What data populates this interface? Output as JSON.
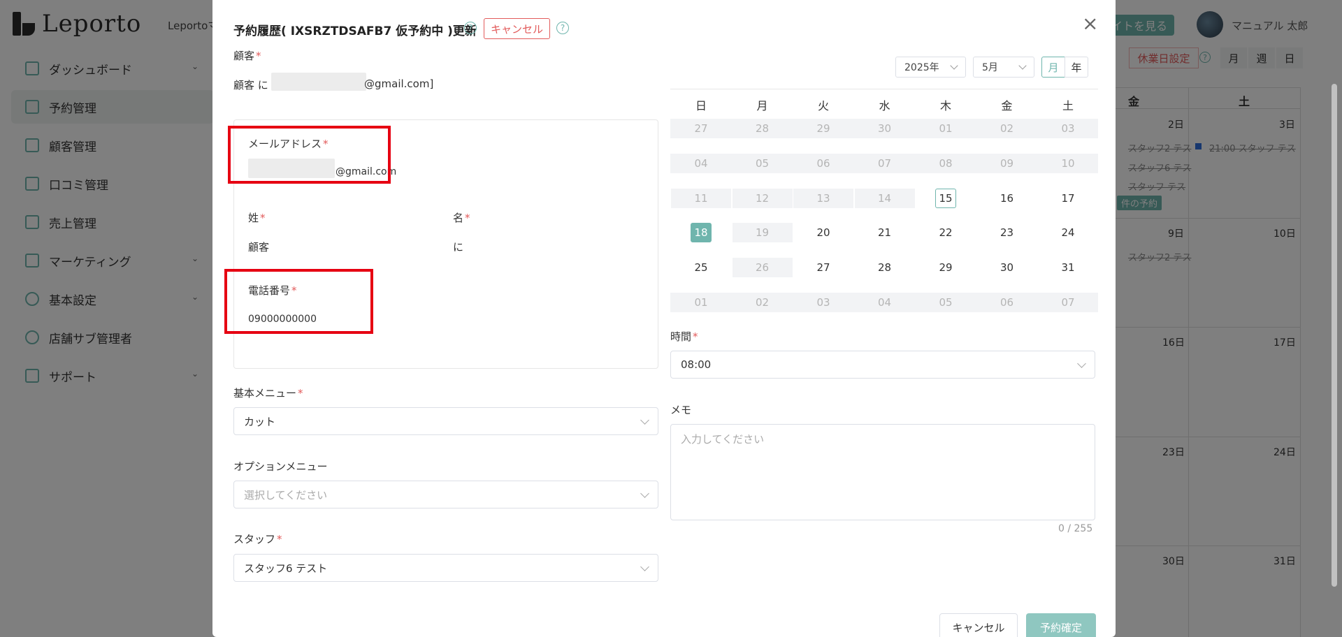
{
  "header": {
    "logo_text": "Leporto",
    "app_name": "Leportoマ",
    "view_site": "イトを見る",
    "user_name": "マニュアル 太郎"
  },
  "sidebar": {
    "items": [
      {
        "label": "ダッシュボード"
      },
      {
        "label": "予約管理"
      },
      {
        "label": "顧客管理"
      },
      {
        "label": "口コミ管理"
      },
      {
        "label": "売上管理"
      },
      {
        "label": "マーケティング"
      },
      {
        "label": "基本設定"
      },
      {
        "label": "店舗サブ管理者"
      },
      {
        "label": "サポート"
      }
    ]
  },
  "background_calendar": {
    "holiday_button": "休業日設定",
    "views": [
      "月",
      "週",
      "日"
    ],
    "day_headers": [
      "金",
      "土"
    ],
    "days": [
      "2日",
      "3日",
      "9日",
      "10日",
      "16日",
      "17日",
      "23日",
      "24日",
      "30日",
      "31日"
    ],
    "events": [
      "スタッフ2 テス",
      "21:00  スタッフ テス",
      "スタッフ6 テス",
      "スタッフ テス",
      "スタッフ2 テス"
    ],
    "badge": "件の予約",
    "event_colors": {
      "blue": "#2f6fdc"
    }
  },
  "modal": {
    "title": "予約履歴( IXSRZTDSAFB7 仮予約中 )更新",
    "status_tag": "キャンセル",
    "customer_label": "顧客",
    "customer_value_prefix": "顧客 に",
    "customer_value_suffix": "@gmail.com]",
    "email_label": "メールアドレス",
    "email_suffix": "@gmail.com",
    "last_name_label": "姓",
    "first_name_label": "名",
    "last_name_value": "顧客",
    "first_name_value": "に",
    "phone_label": "電話番号",
    "phone_value": "09000000000",
    "basic_menu_label": "基本メニュー",
    "basic_menu_value": "カット",
    "option_menu_label": "オプションメニュー",
    "option_menu_placeholder": "選択してください",
    "staff_label": "スタッフ",
    "staff_value": "スタッフ6 テスト",
    "time_label": "時間",
    "time_value": "08:00",
    "memo_label": "メモ",
    "memo_placeholder": "入力してください",
    "memo_counter": "0 / 255",
    "cancel_button": "キャンセル",
    "confirm_button": "予約確定",
    "required_mark": "*"
  },
  "calendar": {
    "year_select": "2025年",
    "month_select": "5月",
    "mode_month": "月",
    "mode_year": "年",
    "weekdays": [
      "日",
      "月",
      "火",
      "水",
      "木",
      "金",
      "土"
    ],
    "weeks": [
      [
        "27",
        "28",
        "29",
        "30",
        "01",
        "02",
        "03"
      ],
      [
        "04",
        "05",
        "06",
        "07",
        "08",
        "09",
        "10"
      ],
      [
        "11",
        "12",
        "13",
        "14",
        "15",
        "16",
        "17"
      ],
      [
        "18",
        "19",
        "20",
        "21",
        "22",
        "23",
        "24"
      ],
      [
        "25",
        "26",
        "27",
        "28",
        "29",
        "30",
        "31"
      ],
      [
        "01",
        "02",
        "03",
        "04",
        "05",
        "06",
        "07"
      ]
    ],
    "today": "15",
    "selected": "18",
    "accent_color": "#6fb5ad"
  },
  "colors": {
    "accent": "#6fb5ad",
    "required": "#e25b5b",
    "highlight_box": "#e60012"
  }
}
